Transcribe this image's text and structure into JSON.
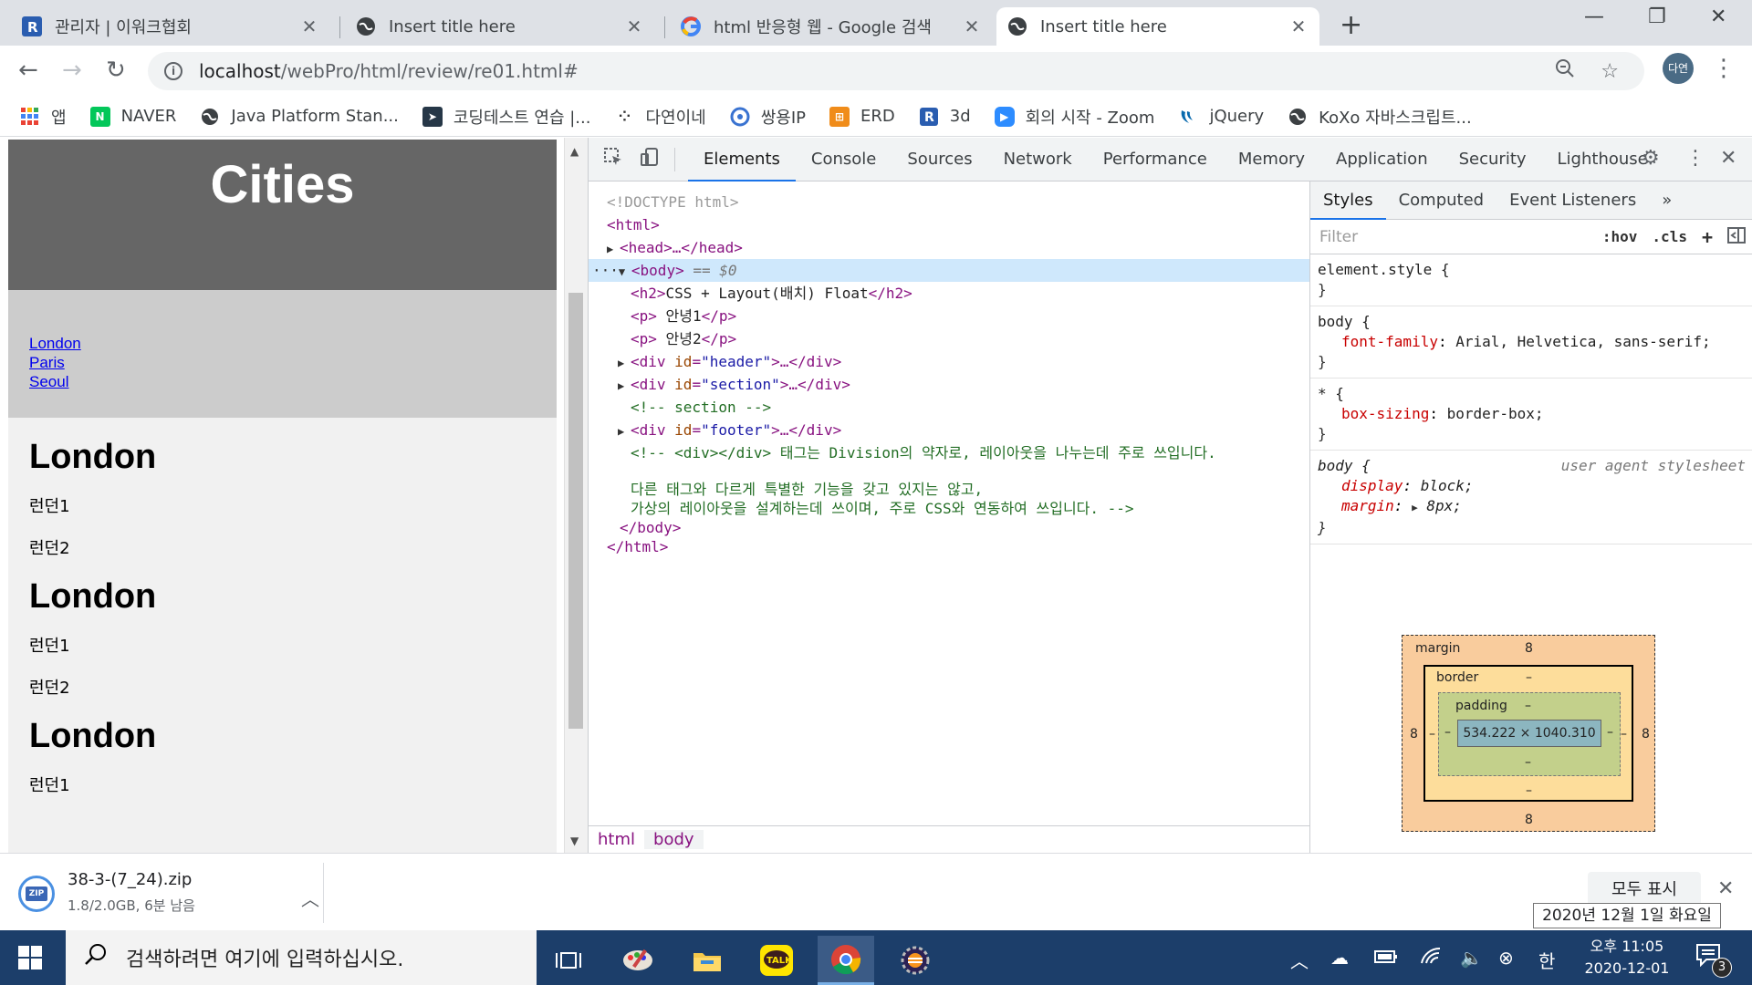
{
  "browser": {
    "tabs": [
      {
        "title": "관리자 | 이워크협회",
        "icon": "r-logo-icon"
      },
      {
        "title": "Insert title here",
        "icon": "globe-icon"
      },
      {
        "title": "html 반응형 웹 - Google 검색",
        "icon": "google-icon"
      },
      {
        "title": "Insert title here",
        "icon": "globe-icon",
        "active": true
      }
    ],
    "new_tab": "+",
    "window_controls": {
      "minimize": "—",
      "restore": "❐",
      "close": "✕"
    },
    "url": {
      "host": "localhost",
      "path": "/webPro/html/review/re01.html#"
    },
    "profile_label": "다연",
    "bookmarks": [
      {
        "label": "앱",
        "icon": "apps-grid-icon"
      },
      {
        "label": "NAVER",
        "icon": "naver-icon"
      },
      {
        "label": "Java Platform Stan...",
        "icon": "globe-icon"
      },
      {
        "label": "코딩테스트 연습 |...",
        "icon": "programmers-icon"
      },
      {
        "label": "다연이네",
        "icon": "dots-icon"
      },
      {
        "label": "쌍용IP",
        "icon": "ssangyong-icon"
      },
      {
        "label": "ERD",
        "icon": "erd-icon"
      },
      {
        "label": "3d",
        "icon": "r-logo-icon"
      },
      {
        "label": "회의 시작 - Zoom",
        "icon": "zoom-icon"
      },
      {
        "label": "jQuery",
        "icon": "jquery-icon"
      },
      {
        "label": "KoXo 자바스크립트...",
        "icon": "globe-icon"
      }
    ]
  },
  "page": {
    "header_title": "Cities",
    "nav_links": [
      "London",
      "Paris",
      "Seoul"
    ],
    "sections": [
      {
        "heading": "London",
        "paragraphs": [
          "런던1",
          "런던2"
        ]
      },
      {
        "heading": "London",
        "paragraphs": [
          "런던1",
          "런던2"
        ]
      },
      {
        "heading": "London",
        "paragraphs": [
          "런던1"
        ]
      }
    ]
  },
  "devtools": {
    "tabs": [
      "Elements",
      "Console",
      "Sources",
      "Network",
      "Performance",
      "Memory",
      "Application",
      "Security",
      "Lighthouse"
    ],
    "active_tab": "Elements",
    "dom": {
      "doctype": "<!DOCTYPE html>",
      "html_open": "<html>",
      "head": "<head>…</head>",
      "body_open": "<body>",
      "body_marker": "== $0",
      "h2_tag_open": "<h2>",
      "h2_text": "CSS + Layout(배치) Float",
      "h2_tag_close": "</h2>",
      "p_tag_open": "<p>",
      "p1_text": " 안녕1",
      "p2_text": " 안녕2",
      "p_tag_close": "</p>",
      "div_open": "<div ",
      "id_attr": "id",
      "header_id": "\"header\"",
      "section_id": "\"section\"",
      "footer_id": "\"footer\"",
      "collapsed_tail": ">…</div>",
      "section_comment": "<!-- section -->",
      "comment_line1": "<!-- <div></div> 태그는 Division의 약자로, 레이아웃을 나누는데 주로 쓰입니다.",
      "comment_line2": "다른 태그와 다르게 특별한 기능을 갖고 있지는 않고,",
      "comment_line3": "가상의 레이아웃을 설계하는데 쓰이며, 주로 CSS와 연동하여 쓰입니다. -->",
      "body_close": "</body>",
      "html_close": "</html>"
    },
    "breadcrumbs": [
      "html",
      "body"
    ],
    "styles_tabs": [
      "Styles",
      "Computed",
      "Event Listeners",
      "»"
    ],
    "filter_placeholder": "Filter",
    "filter_options": [
      ":hov",
      ".cls",
      "+"
    ],
    "rules": {
      "element_style": "element.style {",
      "body_selector": "body {",
      "body_font_prop": "font-family",
      "body_font_val": "Arial, Helvetica, sans-serif;",
      "star_selector": "* {",
      "star_prop": "box-sizing",
      "star_val": "border-box;",
      "ua_selector": "body {",
      "ua_source": "user agent stylesheet",
      "ua_display_prop": "display",
      "ua_display_val": "block;",
      "ua_margin_prop": "margin",
      "ua_margin_val": "8px;",
      "close_brace": "}"
    },
    "box_model": {
      "margin_label": "margin",
      "margin_top": "8",
      "margin_bottom": "8",
      "margin_left": "8",
      "margin_right": "8",
      "border_label": "border",
      "border_value": "–",
      "padding_label": "padding",
      "padding_value": "–",
      "content": "534.222 × 1040.310"
    }
  },
  "download": {
    "filename": "38-3-(7_24).zip",
    "status": "1.8/2.0GB, 6분 남음",
    "progress": 0.9,
    "show_all": "모두 표시",
    "tooltip": "2020년 12월 1일 화요일"
  },
  "taskbar": {
    "search_placeholder": "검색하려면 여기에 입력하십시오.",
    "ime": "한",
    "time": "오후 11:05",
    "date": "2020-12-01",
    "notification_count": "3"
  }
}
